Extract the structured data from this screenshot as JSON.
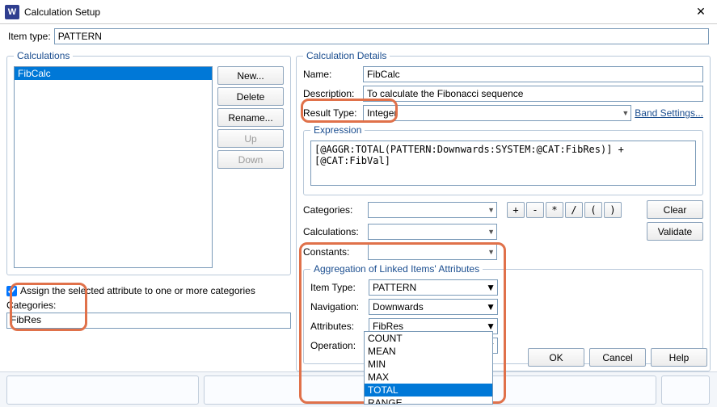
{
  "window": {
    "title": "Calculation Setup"
  },
  "item_type": {
    "label": "Item type:",
    "value": "PATTERN"
  },
  "sidebar": {
    "legend": "Calculations",
    "items": [
      "FibCalc"
    ],
    "buttons": {
      "new": "New...",
      "delete": "Delete",
      "rename": "Rename...",
      "up": "Up",
      "down": "Down"
    },
    "assign_label": "Assign the selected attribute to one or more categories",
    "cat_label": "Categories:",
    "cat_value": "FibRes"
  },
  "details": {
    "legend": "Calculation Details",
    "name_label": "Name:",
    "name_value": "FibCalc",
    "desc_label": "Description:",
    "desc_value": "To calculate the Fibonacci sequence",
    "rtype_label": "Result Type:",
    "rtype_value": "Integer",
    "band_link": "Band Settings...",
    "expr_legend": "Expression",
    "expr_value": "[@AGGR:TOTAL(PATTERN:Downwards:SYSTEM:@CAT:FibRes)] + [@CAT:FibVal]",
    "cats_label": "Categories:",
    "calcs_label": "Calculations:",
    "consts_label": "Constants:",
    "ops": [
      "+",
      "-",
      "*",
      "/",
      "(",
      ")"
    ],
    "clear": "Clear",
    "validate": "Validate",
    "aggr_legend": "Aggregation of Linked Items' Attributes",
    "aggr": {
      "itype_label": "Item Type:",
      "itype_value": "PATTERN",
      "nav_label": "Navigation:",
      "nav_value": "Downwards",
      "attr_label": "Attributes:",
      "attr_value": "FibRes",
      "op_label": "Operation:",
      "op_value": "",
      "options": [
        "COUNT",
        "MEAN",
        "MIN",
        "MAX",
        "TOTAL",
        "RANGE"
      ]
    }
  },
  "buttons": {
    "ok": "OK",
    "cancel": "Cancel",
    "help": "Help"
  }
}
